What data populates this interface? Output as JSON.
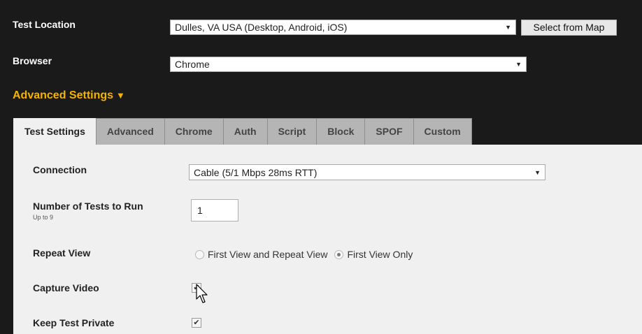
{
  "test_location": {
    "label": "Test Location",
    "value": "Dulles, VA USA (Desktop, Android, iOS)",
    "map_button": "Select from Map"
  },
  "browser": {
    "label": "Browser",
    "value": "Chrome"
  },
  "advanced": {
    "title": "Advanced Settings",
    "toggle_glyph": "▼"
  },
  "tabs": [
    {
      "label": "Test Settings",
      "active": true
    },
    {
      "label": "Advanced",
      "active": false
    },
    {
      "label": "Chrome",
      "active": false
    },
    {
      "label": "Auth",
      "active": false
    },
    {
      "label": "Script",
      "active": false
    },
    {
      "label": "Block",
      "active": false
    },
    {
      "label": "SPOF",
      "active": false
    },
    {
      "label": "Custom",
      "active": false
    }
  ],
  "settings": {
    "connection": {
      "label": "Connection",
      "value": "Cable (5/1 Mbps 28ms RTT)"
    },
    "num_tests": {
      "label": "Number of Tests to Run",
      "sublabel": "Up to 9",
      "value": "1"
    },
    "repeat_view": {
      "label": "Repeat View",
      "options": [
        {
          "label": "First View and Repeat View",
          "checked": false
        },
        {
          "label": "First View Only",
          "checked": true
        }
      ]
    },
    "capture_video": {
      "label": "Capture Video",
      "checked": true
    },
    "keep_private": {
      "label": "Keep Test Private",
      "checked": true
    }
  },
  "colors": {
    "page_bg": "#1a1a1a",
    "accent": "#f5b400",
    "panel_bg": "#f0f0f0",
    "tab_inactive": "#b5b5b5"
  }
}
